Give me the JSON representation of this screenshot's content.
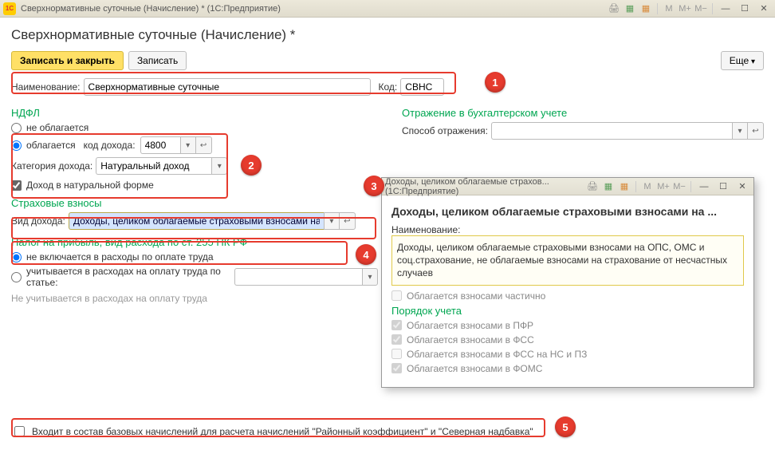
{
  "titlebar": {
    "title": "Сверхнормативные суточные (Начисление) *  (1С:Предприятие)",
    "logo": "1С"
  },
  "page_title": "Сверхнормативные суточные (Начисление) *",
  "toolbar": {
    "write_and_close": "Записать и закрыть",
    "write": "Записать",
    "more": "Еще"
  },
  "name_field": {
    "label": "Наименование:",
    "value": "Сверхнормативные суточные"
  },
  "code_field": {
    "label": "Код:",
    "value": "СВНС"
  },
  "ndfl": {
    "title": "НДФЛ",
    "opt_not": "не облагается",
    "opt_tax": "облагается",
    "code_label": "код дохода:",
    "code_value": "4800",
    "category_label": "Категория дохода:",
    "category_value": "Натуральный доход",
    "natural_check": "Доход в натуральной форме"
  },
  "accounting": {
    "title": "Отражение в бухгалтерском учете",
    "way_label": "Способ отражения:"
  },
  "insurance": {
    "title": "Страховые взносы",
    "kind_label": "Вид дохода:",
    "kind_value": "Доходы, целиком облагаемые страховыми взносами на ОПС"
  },
  "profit_tax": {
    "title": "Налог на прибыль, вид расхода по ст. 255 НК РФ",
    "opt_not": "не включается в расходы по оплате труда",
    "opt_in": "учитывается в расходах на оплату труда по статье:",
    "note": "Не учитывается в расходах на оплату труда"
  },
  "subwin": {
    "titlebar": "Доходы, целиком облагаемые страхов...   (1С:Предприятие)",
    "heading": "Доходы, целиком облагаемые страховыми взносами на ...",
    "name_label": "Наименование:",
    "name_text": "Доходы, целиком облагаемые страховыми взносами на ОПС, ОМС и соц.страхование, не облагаемые взносами на страхование от несчастных случаев",
    "partial": "Облагается взносами частично",
    "order_title": "Порядок учета",
    "pfr": "Облагается взносами в ПФР",
    "fss": "Облагается взносами в ФСС",
    "fss_ns": "Облагается взносами в ФСС на НС и ПЗ",
    "foms": "Облагается взносами в ФОМС"
  },
  "bottom": {
    "text": "Входит в состав базовых начислений для расчета начислений \"Районный коэффициент\" и \"Северная надбавка\""
  },
  "callouts": {
    "c1": "1",
    "c2": "2",
    "c3": "3",
    "c4": "4",
    "c5": "5"
  }
}
